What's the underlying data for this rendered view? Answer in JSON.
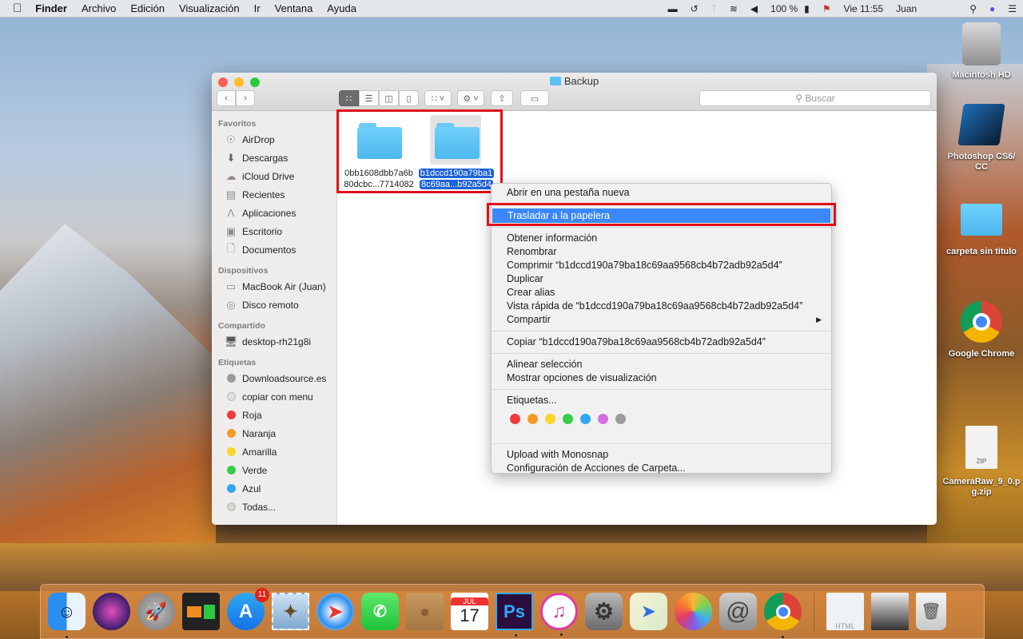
{
  "menubar": {
    "apple_icon": "apple-icon",
    "app_name": "Finder",
    "items": [
      "Archivo",
      "Edición",
      "Visualización",
      "Ir",
      "Ventana",
      "Ayuda"
    ],
    "status": {
      "battery": "100 %",
      "clock": "Vie 11:55",
      "user": "Juan"
    }
  },
  "window": {
    "title": "Backup",
    "search_placeholder": "Buscar"
  },
  "sidebar": {
    "sections": [
      {
        "title": "Favoritos",
        "items": [
          {
            "label": "AirDrop",
            "icon": "airdrop-icon"
          },
          {
            "label": "Descargas",
            "icon": "download-icon"
          },
          {
            "label": "iCloud Drive",
            "icon": "cloud-icon"
          },
          {
            "label": "Recientes",
            "icon": "recents-icon"
          },
          {
            "label": "Aplicaciones",
            "icon": "applications-icon"
          },
          {
            "label": "Escritorio",
            "icon": "desktop-icon"
          },
          {
            "label": "Documentos",
            "icon": "documents-icon"
          }
        ]
      },
      {
        "title": "Dispositivos",
        "items": [
          {
            "label": "MacBook Air (Juan)",
            "icon": "laptop-icon"
          },
          {
            "label": "Disco remoto",
            "icon": "disc-icon"
          }
        ]
      },
      {
        "title": "Compartido",
        "items": [
          {
            "label": "desktop-rh21g8i",
            "icon": "computer-icon"
          }
        ]
      },
      {
        "title": "Etiquetas",
        "items": [
          {
            "label": "Downloadsource.es",
            "color": "#9b9b9b"
          },
          {
            "label": "copiar con menu",
            "color": "#d7d7d7"
          },
          {
            "label": "Roja",
            "color": "#f2393a"
          },
          {
            "label": "Naranja",
            "color": "#f89a2a"
          },
          {
            "label": "Amarilla",
            "color": "#fbd52a"
          },
          {
            "label": "Verde",
            "color": "#37cd4a"
          },
          {
            "label": "Azul",
            "color": "#2fa8f2"
          },
          {
            "label": "Todas...",
            "color": "#cfcfcf"
          }
        ]
      }
    ]
  },
  "files": [
    {
      "name_line1": "0bb1608dbb7a6b",
      "name_line2": "80dcbc...7714082",
      "selected": false
    },
    {
      "name_line1": "b1dccd190a79ba1",
      "name_line2": "8c69aa...b92a5d4",
      "selected": true
    }
  ],
  "context_menu": {
    "open_new_tab": "Abrir en una pestaña nueva",
    "move_to_trash": "Trasladar a la papelera",
    "get_info": "Obtener información",
    "rename": "Renombrar",
    "compress": "Comprimir “b1dccd190a79ba18c69aa9568cb4b72adb92a5d4”",
    "duplicate": "Duplicar",
    "make_alias": "Crear alias",
    "quick_look": "Vista rápida de “b1dccd190a79ba18c69aa9568cb4b72adb92a5d4”",
    "share": "Compartir",
    "copy": "Copiar “b1dccd190a79ba18c69aa9568cb4b72adb92a5d4”",
    "clean_up": "Alinear selección",
    "view_options": "Mostrar opciones de visualización",
    "tags": "Etiquetas...",
    "tag_colors": [
      "#f2393a",
      "#f89a2a",
      "#fbd52a",
      "#37cd4a",
      "#2fa8f2",
      "#d66ee0",
      "#9b9b9b"
    ],
    "monosnap": "Upload with Monosnap",
    "folder_actions": "Configuración de Acciones de Carpeta..."
  },
  "desktop_icons": [
    {
      "label": "Macintosh HD"
    },
    {
      "label": "Photoshop CS6/ CC"
    },
    {
      "label": "carpeta sin título"
    },
    {
      "label": "Google Chrome"
    },
    {
      "label": "CameraRaw_9_0.p g.zip"
    }
  ],
  "dock": {
    "app_store_badge": "11",
    "calendar_month": "JUL",
    "calendar_day": "17",
    "photoshop_label": "Ps"
  },
  "colors": {
    "highlight": "#3b88fd",
    "annotation_red": "#e0101b",
    "selection_blue": "#1d63d6"
  }
}
